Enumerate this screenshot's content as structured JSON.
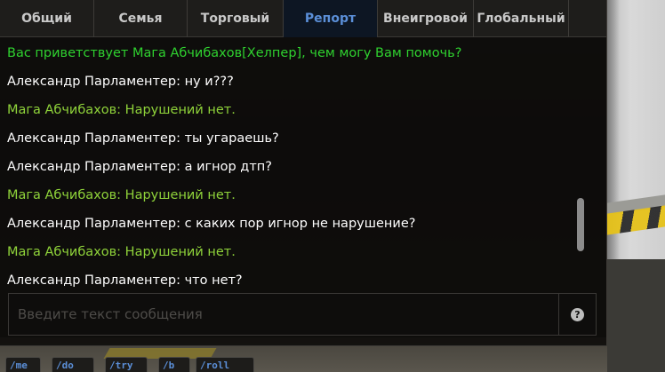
{
  "tabs": [
    {
      "label": "Общий",
      "active": false
    },
    {
      "label": "Семья",
      "active": false
    },
    {
      "label": "Торговый",
      "active": false
    },
    {
      "label": "Репорт",
      "active": true
    },
    {
      "label": "Внеигровой",
      "active": false
    },
    {
      "label": "Глобальный",
      "active": false
    }
  ],
  "messages": [
    {
      "text": "Вас приветствует Мага Абчибахов[Хелпер], чем могу Вам помочь?",
      "color": "#2fd12f"
    },
    {
      "text": "Александр Парламентер: ну и???",
      "color": "#ffffff"
    },
    {
      "text": "Мага Абчибахов: Нарушений нет.",
      "color": "#8fd33a"
    },
    {
      "text": "Александр Парламентер: ты угараешь?",
      "color": "#ffffff"
    },
    {
      "text": "Александр Парламентер: а игнор дтп?",
      "color": "#ffffff"
    },
    {
      "text": "Мага Абчибахов: Нарушений нет.",
      "color": "#8fd33a"
    },
    {
      "text": "Александр Парламентер: с каких пор игнор не нарушение?",
      "color": "#ffffff"
    },
    {
      "text": "Мага Абчибахов: Нарушений нет.",
      "color": "#8fd33a"
    },
    {
      "text": "Александр Парламентер: что нет?",
      "color": "#ffffff"
    }
  ],
  "input": {
    "value": "",
    "placeholder": "Введите текст сообщения"
  },
  "help": {
    "glyph": "?",
    "icon": "question-circle-icon"
  },
  "commands": [
    {
      "label": "/me"
    },
    {
      "label": "/do"
    },
    {
      "label": "/try"
    },
    {
      "label": "/b"
    },
    {
      "label": "/roll"
    }
  ],
  "colors": {
    "accent": "#5b8fd8",
    "welcome": "#2fd12f",
    "helper": "#8fd33a",
    "player": "#ffffff"
  }
}
